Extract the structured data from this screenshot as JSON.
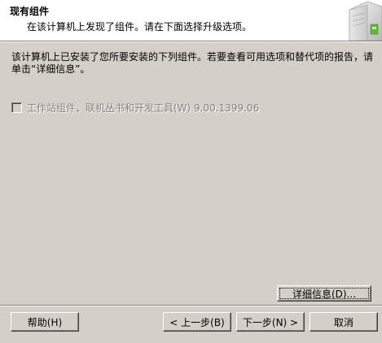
{
  "header": {
    "title": "现有组件",
    "subtitle": "在该计算机上发现了组件。请在下面选择升级选项。"
  },
  "description": "该计算机上已安装了您所要安装的下列组件。若要查看可用选项和替代项的报告，请单击“详细信息”。",
  "component": {
    "checked": false,
    "label": "工作站组件、联机丛书和开发工具(W)  9.00.1399.06"
  },
  "buttons": {
    "details": "详细信息(D)...",
    "help": "帮助(H)",
    "back": "< 上一步(B)",
    "next": "下一步(N) >",
    "cancel": "取消"
  },
  "colors": {
    "dialog_bg": "#d4d0c8",
    "header_bg": "#ffffff",
    "disabled_text": "#808080"
  }
}
